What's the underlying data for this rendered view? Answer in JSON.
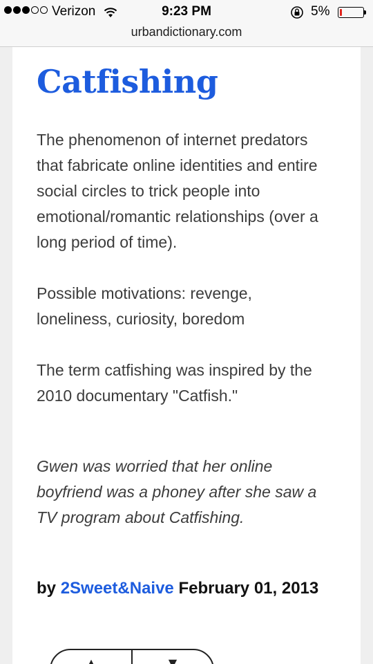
{
  "status_bar": {
    "carrier": "Verizon",
    "time": "9:23 PM",
    "battery_percent": "5%",
    "signal_full": 3,
    "signal_total": 5,
    "battery_color": "#e0231b"
  },
  "browser": {
    "url": "urbandictionary.com"
  },
  "entry": {
    "word": "Catfishing",
    "meaning": [
      "The phenomenon of internet predators that fabricate online identities and entire social circles to trick people into emotional/romantic relationships (over a long period of time).",
      "Possible motivations: revenge, loneliness, curiosity, boredom",
      "The term catfishing was inspired by the 2010 documentary \"Catfish.\""
    ],
    "example": "Gwen was worried that her online boyfriend was a phoney after she saw a TV program about Catfishing.",
    "by_label": "by",
    "author": "2Sweet&Naive",
    "date": "February 01, 2013",
    "accent_color": "#1d5cde"
  },
  "icons": {
    "wifi": "wifi-icon",
    "lock": "rotation-lock-icon",
    "battery": "battery-icon",
    "upvote": "thumbs-up-icon",
    "downvote": "thumbs-down-icon"
  }
}
